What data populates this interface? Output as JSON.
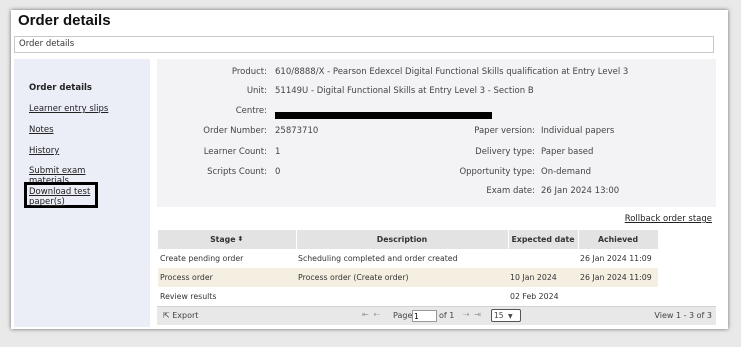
{
  "page_title": "Order details",
  "breadcrumb": "Order details",
  "sidebar": {
    "items": [
      {
        "label": "Order details"
      },
      {
        "label": "Learner entry slips"
      },
      {
        "label": "Notes"
      },
      {
        "label": "History"
      },
      {
        "label": "Submit exam materials",
        "line1": "Submit exam",
        "line2": "materials"
      },
      {
        "label": "Download test paper(s)",
        "line1": "Download test",
        "line2": "paper(s)"
      }
    ]
  },
  "info": {
    "product_label": "Product:",
    "product_value": "610/8888/X - Pearson Edexcel Digital Functional Skills qualification at Entry Level 3",
    "unit_label": "Unit:",
    "unit_value": "51149U - Digital Functional Skills at Entry Level 3 - Section B",
    "centre_label": "Centre:",
    "order_number_label": "Order Number:",
    "order_number_value": "25873710",
    "learner_count_label": "Learner Count:",
    "learner_count_value": "1",
    "scripts_count_label": "Scripts Count:",
    "scripts_count_value": "0",
    "paper_version_label": "Paper version:",
    "paper_version_value": "Individual papers",
    "delivery_type_label": "Delivery type:",
    "delivery_type_value": "Paper based",
    "opportunity_type_label": "Opportunity type:",
    "opportunity_type_value": "On-demand",
    "exam_date_label": "Exam date:",
    "exam_date_value": "26 Jan 2024 13:00"
  },
  "rollback_label": "Rollback order stage",
  "table": {
    "headers": [
      "Stage",
      "Description",
      "Expected date",
      "Achieved"
    ],
    "rows": [
      [
        "Create pending order",
        "Scheduling completed and order created",
        "",
        "26 Jan 2024 11:09"
      ],
      [
        "Process order",
        "Process order (Create order)",
        "10 Jan 2024",
        "26 Jan 2024 11:09"
      ],
      [
        "Review results",
        "",
        "02 Feb 2024",
        ""
      ]
    ]
  },
  "pager": {
    "export_label": "Export",
    "page_label": "Page",
    "page_value": "1",
    "of_label": "of 1",
    "page_size": "15",
    "view_label": "View 1 - 3 of 3"
  }
}
